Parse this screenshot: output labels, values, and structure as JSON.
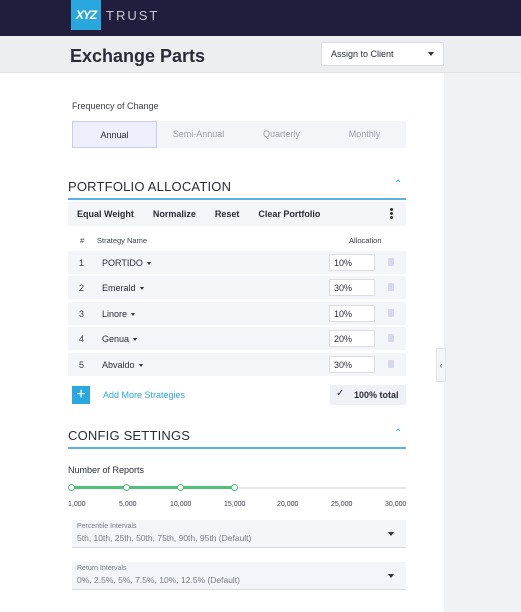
{
  "brand": {
    "mark": "XYZ",
    "name": "TRUST"
  },
  "header": {
    "title": "Exchange Parts",
    "assign_label": "Assign to Client"
  },
  "frequency": {
    "label": "Frequency of Change",
    "options": [
      "Annual",
      "Semi-Annual",
      "Quarterly",
      "Monthly"
    ],
    "selected": "Annual"
  },
  "portfolio": {
    "title": "PORTFOLIO ALLOCATION",
    "toolbar": [
      "Equal Weight",
      "Normalize",
      "Reset",
      "Clear Portfolio"
    ],
    "columns": {
      "num": "#",
      "name": "Strategy Name",
      "alloc": "Allocation"
    },
    "rows": [
      {
        "num": "1",
        "name": "PORTIDO",
        "alloc": "10%"
      },
      {
        "num": "2",
        "name": "Emerald",
        "alloc": "30%"
      },
      {
        "num": "3",
        "name": "Linore",
        "alloc": "10%"
      },
      {
        "num": "4",
        "name": "Genua",
        "alloc": "20%"
      },
      {
        "num": "5",
        "name": "Abvaldo",
        "alloc": "30%"
      }
    ],
    "add_label": "Add More Strategies",
    "total_label": "100% total"
  },
  "config": {
    "title": "CONFIG SETTINGS",
    "reports_label": "Number of Reports",
    "slider_ticks": [
      "1,000",
      "5,000",
      "10,000",
      "15,000",
      "20,000",
      "25,000",
      "30,000"
    ],
    "slider_value": "15,000",
    "percentile": {
      "label": "Percentile Intervals",
      "value": "5th, 10th, 25th, 50th, 75th, 90th, 95th (Default)"
    },
    "return": {
      "label": "Return Intervals",
      "value": "0%, 2.5%, 5%, 7.5%, 10%, 12.5% (Default)"
    }
  },
  "colors": {
    "accent": "#29a8df",
    "topbar": "#201d3d",
    "slider": "#4fbf7a"
  }
}
